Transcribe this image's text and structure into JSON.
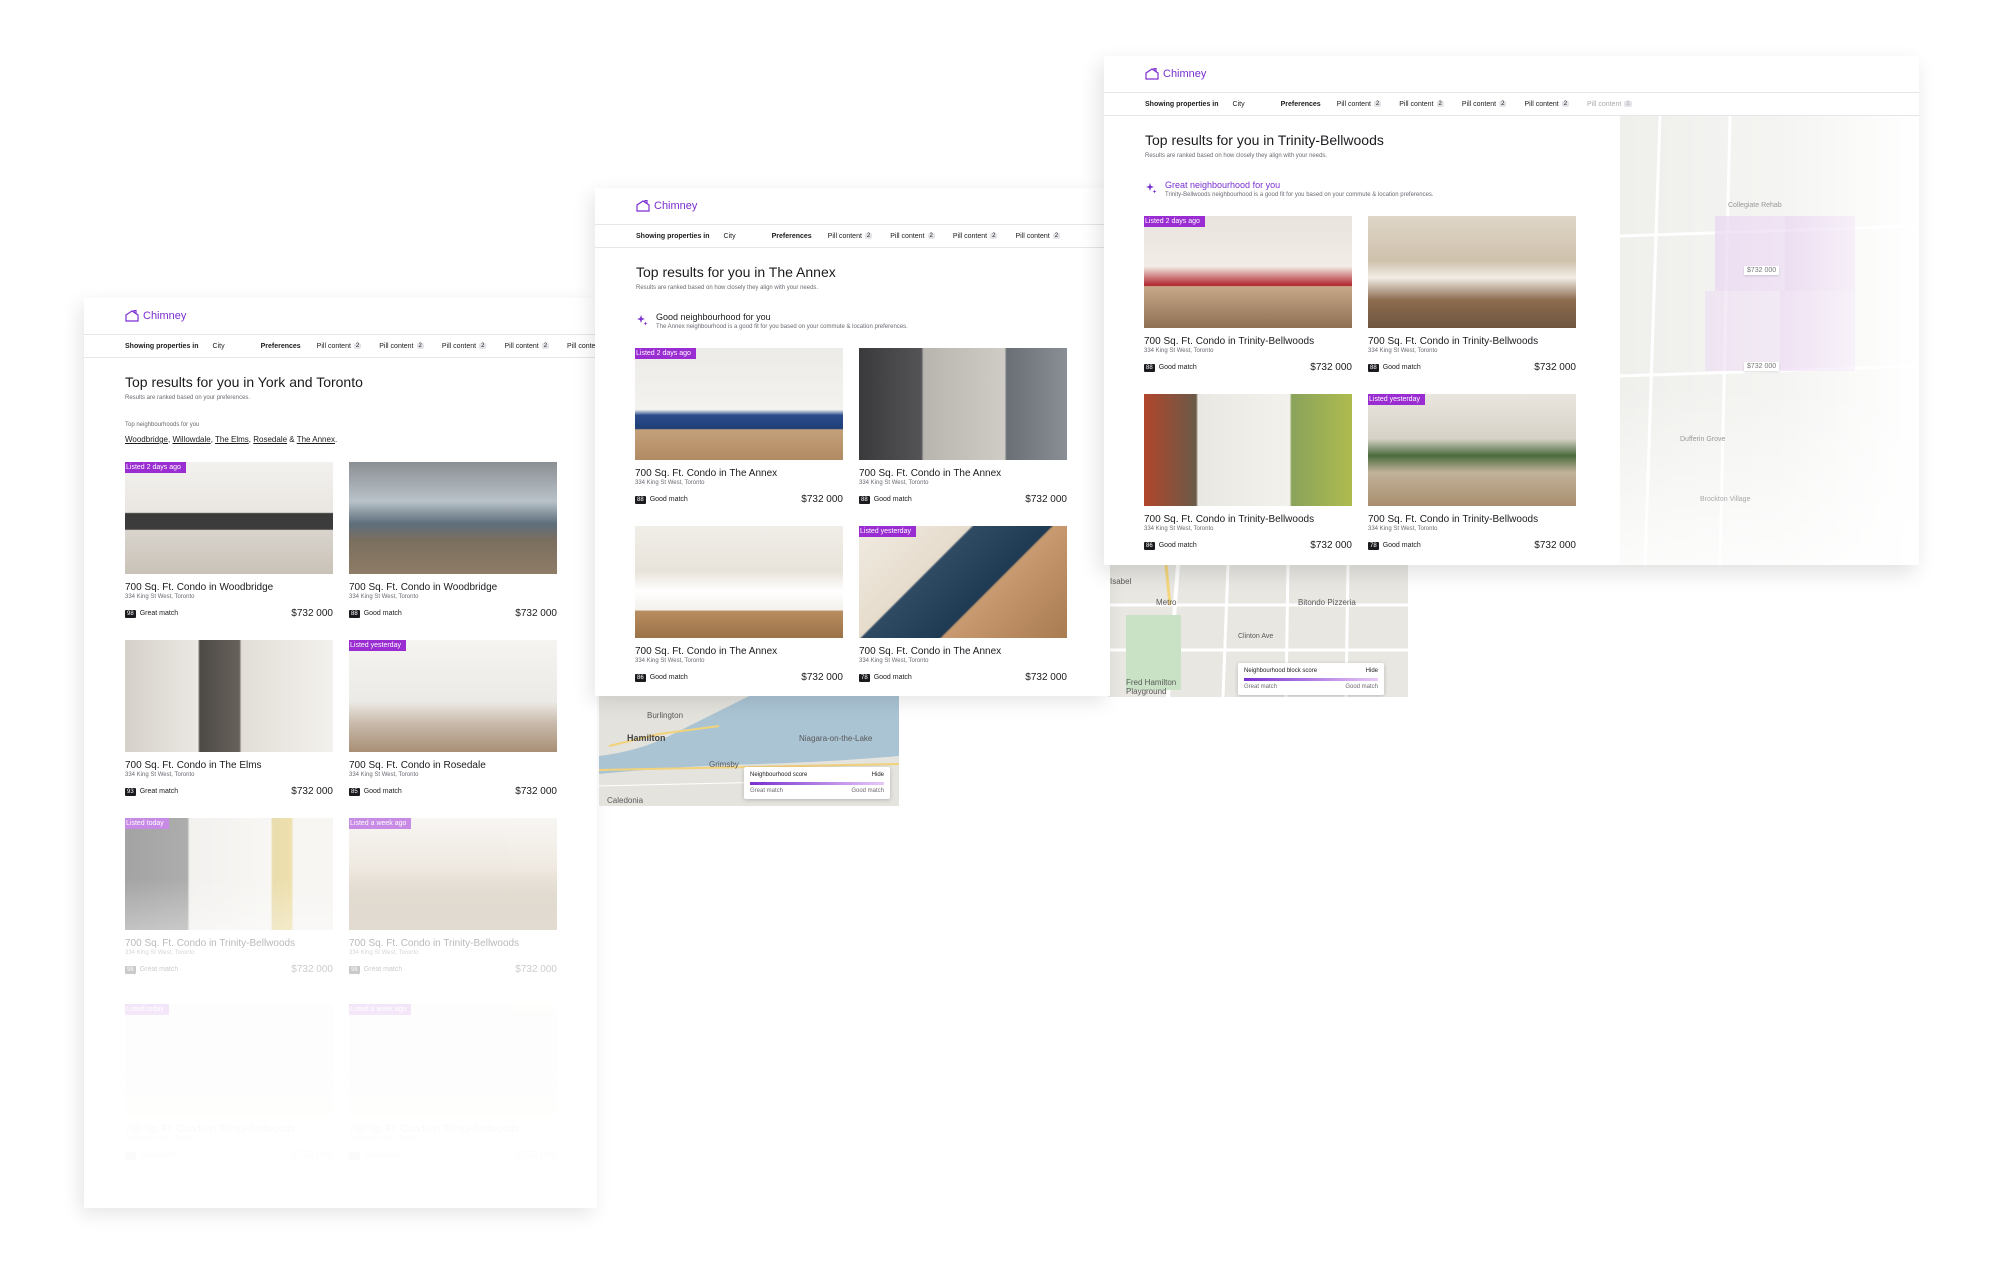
{
  "brand": {
    "name": "Chimney",
    "color": "#7a2fd0",
    "tag_color": "#9a2dd1"
  },
  "filter": {
    "label": "Showing properties in",
    "city": "City",
    "preferences": "Preferences",
    "pill_label": "Pill content",
    "pill_count": "2"
  },
  "screen1": {
    "title": "Top results for you in York and Toronto",
    "subtitle": "Results are ranked based on your preferences.",
    "top_neighbourhoods_label": "Top neighbourhoods for you",
    "neighbourhoods": [
      "Woodbridge",
      "Willowdale",
      "The Elms",
      "Rosedale",
      "The Annex"
    ],
    "sep_comma": ", ",
    "sep_amp": " & ",
    "period": ".",
    "cards": [
      {
        "tag": "Listed 2 days ago",
        "title": "700 Sq. Ft. Condo in Woodbridge",
        "address": "334 King St West, Toronto",
        "score": "98",
        "match": "Great match",
        "price": "$732 000"
      },
      {
        "tag": "",
        "title": "700 Sq. Ft. Condo in Woodbridge",
        "address": "334 King St West, Toronto",
        "score": "88",
        "match": "Good match",
        "price": "$732 000"
      },
      {
        "tag": "",
        "title": "700 Sq. Ft. Condo in The Elms",
        "address": "334 King St West, Toronto",
        "score": "93",
        "match": "Great match",
        "price": "$732 000"
      },
      {
        "tag": "Listed yesterday",
        "title": "700 Sq. Ft. Condo in Rosedale",
        "address": "334 King St West, Toronto",
        "score": "85",
        "match": "Good match",
        "price": "$732 000"
      },
      {
        "tag": "Listed today",
        "title": "700 Sq. Ft. Condo in Trinity-Bellwoods",
        "address": "334 King St West, Toronto",
        "score": "98",
        "match": "Great match",
        "price": "$732 000"
      },
      {
        "tag": "Listed a week ago",
        "title": "700 Sq. Ft. Condo in Trinity-Bellwoods",
        "address": "334 King St West, Toronto",
        "score": "98",
        "match": "Great match",
        "price": "$732 000"
      },
      {
        "tag": "Listed today",
        "title": "700 Sq. Ft. Condo in Trinity-Bellwoods",
        "address": "334 King St West, Toronto",
        "score": "98",
        "match": "Good match",
        "price": "$732 000"
      },
      {
        "tag": "Listed a week ago",
        "title": "700 Sq. Ft. Condo in Trinity-Bellwoods",
        "address": "334 King St West, Toronto",
        "score": "98",
        "match": "Great match",
        "price": "$732 000"
      }
    ]
  },
  "screen2": {
    "title": "Top results for you in The Annex",
    "subtitle": "Results are ranked based on how closely they align with your needs.",
    "nb_title": "Good neighbourhood for you",
    "nb_desc": "The Annex neighbourhood is a good fit for you based on your commute & location preferences.",
    "cards": [
      {
        "tag": "Listed 2 days ago",
        "title": "700 Sq. Ft. Condo in The Annex",
        "address": "334 King St West, Toronto",
        "score": "88",
        "match": "Good match",
        "price": "$732 000"
      },
      {
        "tag": "",
        "title": "700 Sq. Ft. Condo in The Annex",
        "address": "334 King St West, Toronto",
        "score": "88",
        "match": "Good match",
        "price": "$732 000"
      },
      {
        "tag": "",
        "title": "700 Sq. Ft. Condo in The Annex",
        "address": "334 King St West, Toronto",
        "score": "86",
        "match": "Good match",
        "price": "$732 000"
      },
      {
        "tag": "Listed yesterday",
        "title": "700 Sq. Ft. Condo in The Annex",
        "address": "334 King St West, Toronto",
        "score": "78",
        "match": "Good match",
        "price": "$732 000"
      }
    ],
    "map": {
      "legend_title": "Neighbourhood score",
      "hide": "Hide",
      "left": "Great match",
      "right": "Good match",
      "labels": [
        "Burlington",
        "Hamilton",
        "Grimsby",
        "Niagara-on-the-Lake",
        "Caledonia"
      ]
    }
  },
  "screen3": {
    "title": "Top results for you in Trinity-Bellwoods",
    "subtitle": "Results are ranked based on how closely they align with your needs.",
    "nb_title": "Great neighbourhood for you",
    "nb_desc": "Trinity-Bellwoods neighbourhood is a good fit for you based on your commute & location preferences.",
    "cards": [
      {
        "tag": "Listed 2 days ago",
        "title": "700 Sq. Ft. Condo in Trinity-Bellwoods",
        "address": "334 King St West, Toronto",
        "score": "88",
        "match": "Good match",
        "price": "$732 000"
      },
      {
        "tag": "",
        "title": "700 Sq. Ft. Condo in Trinity-Bellwoods",
        "address": "334 King St West, Toronto",
        "score": "88",
        "match": "Good match",
        "price": "$732 000"
      },
      {
        "tag": "",
        "title": "700 Sq. Ft. Condo in Trinity-Bellwoods",
        "address": "334 King St West, Toronto",
        "score": "86",
        "match": "Good match",
        "price": "$732 000"
      },
      {
        "tag": "Listed yesterday",
        "title": "700 Sq. Ft. Condo in Trinity-Bellwoods",
        "address": "334 King St West, Toronto",
        "score": "78",
        "match": "Good match",
        "price": "$732 000"
      }
    ],
    "map": {
      "legend_title": "Neighbourhood block score",
      "hide": "Hide",
      "left": "Great match",
      "right": "Good match",
      "labels": [
        "Isabel",
        "Metro",
        "Bitondo Pizzeria",
        "Fred Hamilton Playground",
        "Clinton Ave"
      ],
      "side_labels": [
        "Collegiate Rehab",
        "Dufferin Grove",
        "Brockton Village"
      ],
      "pins": [
        "$732 000",
        "$732 000"
      ]
    }
  }
}
